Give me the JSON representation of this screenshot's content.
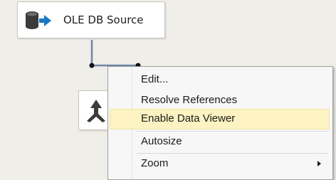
{
  "canvas": {
    "source_component": {
      "label": "OLE DB Source",
      "icon": "ole-db-source-icon"
    },
    "destination_component": {
      "icon": "merge-icon"
    }
  },
  "context_menu": {
    "items": [
      {
        "label": "Edit..."
      },
      {
        "label": "Resolve References"
      },
      {
        "label": "Enable Data Viewer",
        "highlighted": true
      },
      {
        "label": "Autosize"
      },
      {
        "label": "Zoom",
        "has_submenu": true
      }
    ]
  },
  "colors": {
    "canvas_bg": "#f0eee9",
    "menu_highlight": "#fcf2c2",
    "connector": "#6f86a6"
  }
}
